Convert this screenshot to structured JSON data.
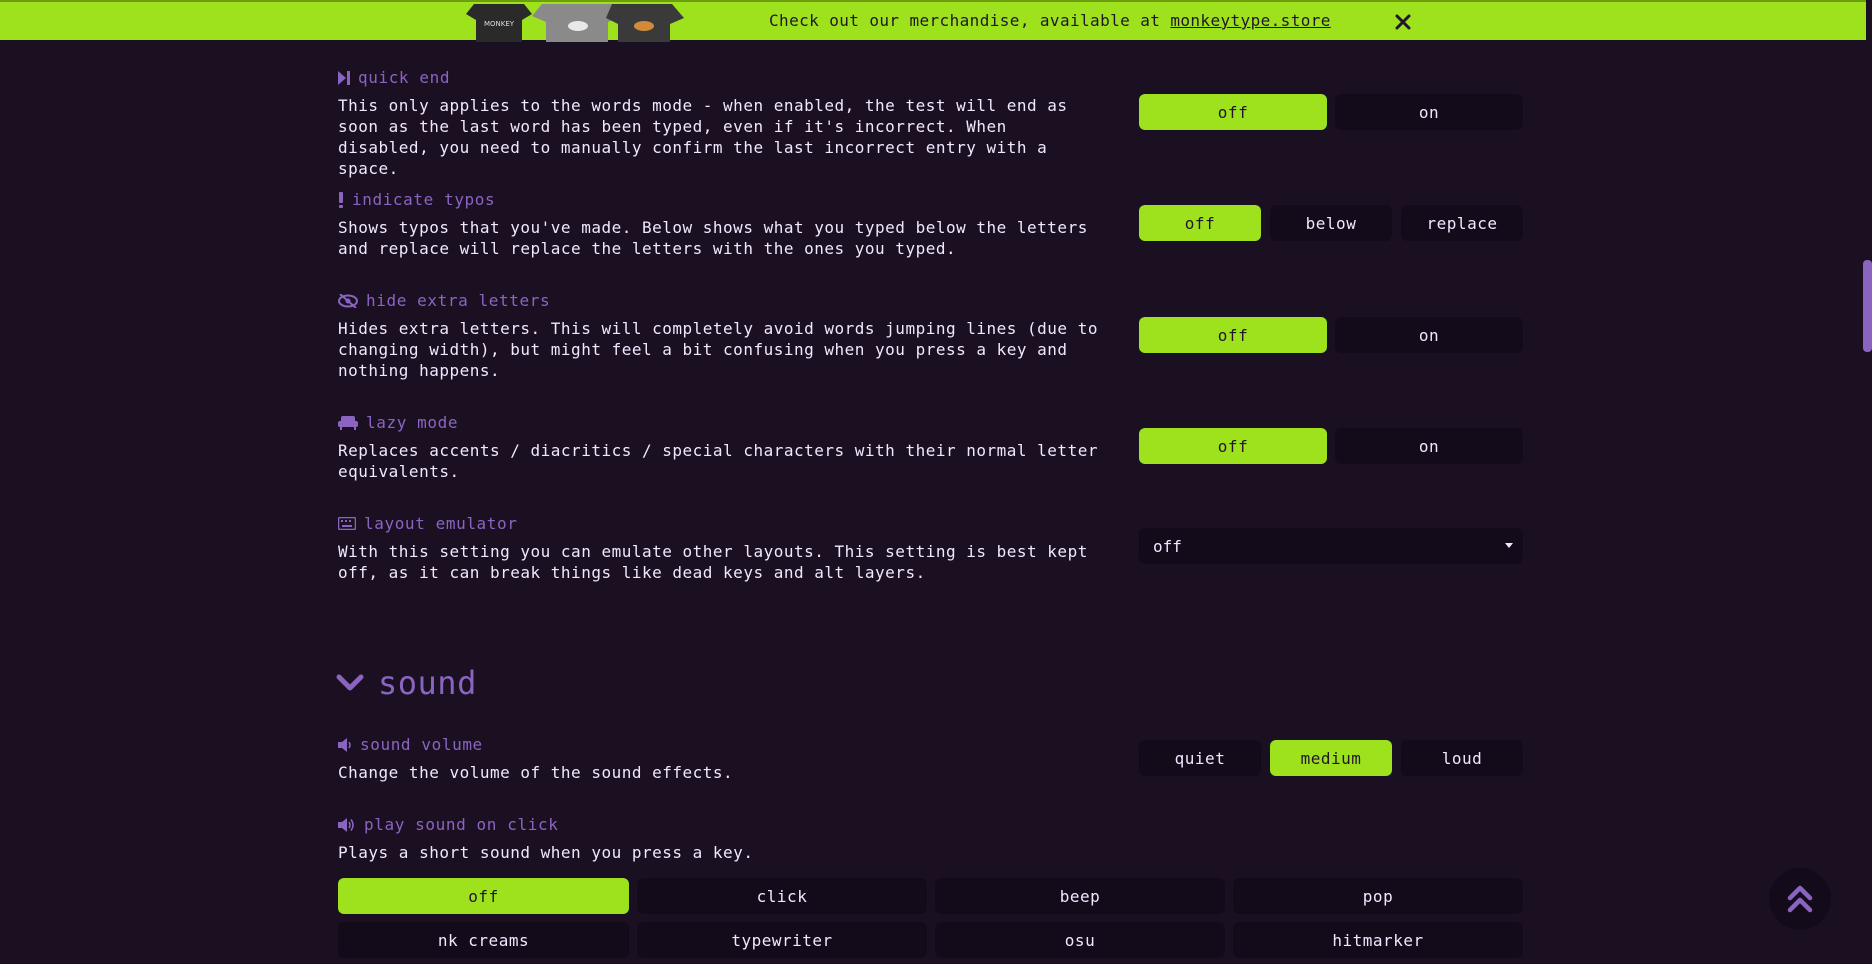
{
  "banner": {
    "text": "Check out our merchandise, available at ",
    "link": "monkeytype.store",
    "art_label": "MONKEY"
  },
  "settings": {
    "quick_end": {
      "title": "quick end",
      "icon": "step-forward-icon",
      "desc": "This only applies to the words mode - when enabled, the test will end as soon as the last word has been typed, even if it's incorrect. When disabled, you need to manually confirm the last incorrect entry with a space.",
      "options": [
        "off",
        "on"
      ],
      "selected": "off"
    },
    "indicate_typos": {
      "title": "indicate typos",
      "icon": "exclamation-icon",
      "desc": "Shows typos that you've made. Below shows what you typed below the letters and replace will replace the letters with the ones you typed.",
      "options": [
        "off",
        "below",
        "replace"
      ],
      "selected": "off"
    },
    "hide_extra_letters": {
      "title": "hide extra letters",
      "icon": "eye-slash-icon",
      "desc": "Hides extra letters. This will completely avoid words jumping lines (due to changing width), but might feel a bit confusing when you press a key and nothing happens.",
      "options": [
        "off",
        "on"
      ],
      "selected": "off"
    },
    "lazy_mode": {
      "title": "lazy mode",
      "icon": "couch-icon",
      "desc": "Replaces accents / diacritics / special characters with their normal letter equivalents.",
      "options": [
        "off",
        "on"
      ],
      "selected": "off"
    },
    "layout_emulator": {
      "title": "layout emulator",
      "icon": "keyboard-icon",
      "desc": "With this setting you can emulate other layouts. This setting is best kept off, as it can break things like dead keys and alt layers.",
      "value": "off"
    }
  },
  "sound_section": {
    "title": "sound",
    "sound_volume": {
      "title": "sound volume",
      "icon": "volume-low-icon",
      "desc": "Change the volume of the sound effects.",
      "options": [
        "quiet",
        "medium",
        "loud"
      ],
      "selected": "medium"
    },
    "play_sound_on_click": {
      "title": "play sound on click",
      "icon": "volume-high-icon",
      "desc": "Plays a short sound when you press a key.",
      "options": [
        "off",
        "click",
        "beep",
        "pop",
        "nk creams",
        "typewriter",
        "osu",
        "hitmarker"
      ],
      "selected": "off"
    }
  },
  "colors": {
    "bg": "#1b1022",
    "accent": "#9de21d",
    "sub": "#8b64c2",
    "text": "#f1e8ff",
    "button_bg": "#140b1a"
  }
}
